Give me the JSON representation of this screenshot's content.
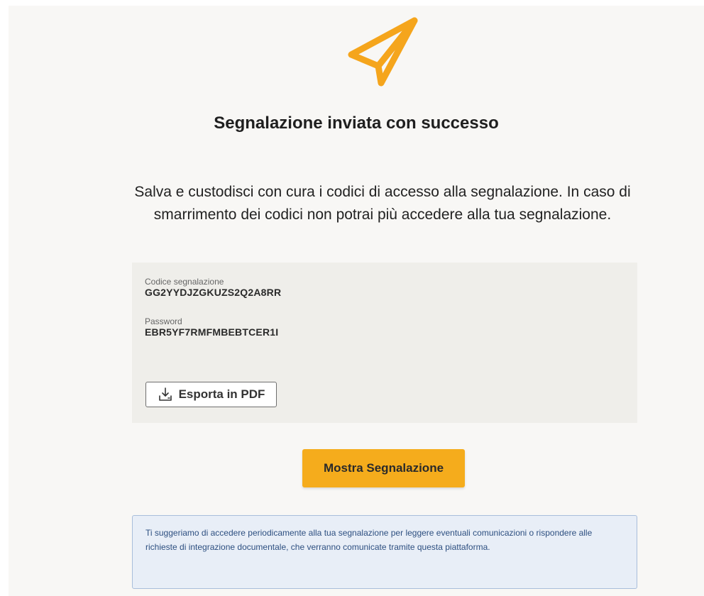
{
  "icons": {
    "logo": "paper-plane-icon",
    "export": "download-tray-icon"
  },
  "colors": {
    "accent": "#f5a51c",
    "primary_button": "#f5ac1c",
    "info_background": "#e8eef7",
    "info_border": "#a9bedb",
    "info_text": "#2d4f80"
  },
  "header": {
    "title": "Segnalazione inviata con successo",
    "message": "Salva e custodisci con cura i codici di accesso alla segnalazione. In caso di smarrimento dei codici non potrai più accedere alla tua segnalazione."
  },
  "codes": {
    "report_code_label": "Codice segnalazione",
    "report_code_value": "GG2YYDJZGKUZS2Q2A8RR",
    "password_label": "Password",
    "password_value": "EBR5YF7RMFMBEBTCER1I",
    "export_label": "Esporta in PDF"
  },
  "actions": {
    "show_report_label": "Mostra Segnalazione"
  },
  "notice": {
    "text": "Ti suggeriamo di accedere periodicamente alla tua segnalazione per leggere eventuali comunicazioni o rispondere alle richieste di integrazione documentale, che verranno comunicate tramite questa piattaforma."
  }
}
